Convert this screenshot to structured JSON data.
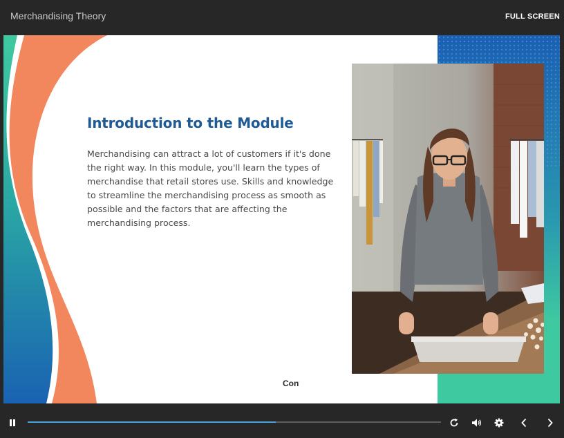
{
  "header": {
    "title": "Merchandising Theory",
    "fullscreen_label": "FULL SCREEN"
  },
  "slide": {
    "heading": "Introduction to the Module",
    "body": "Merchandising can attract a lot of customers if it's done the right way. In this module, you'll learn the types of merchandise that retail stores use. Skills and knowledge to streamline the merchandising process as smooth as possible and the factors that are affecting the merchandising process.",
    "continue_label": "Continue"
  },
  "player": {
    "progress": 0.6
  },
  "colors": {
    "heading": "#1f5a94",
    "accent_orange": "#f2865c",
    "teal": "#3fc9a0",
    "blue": "#1a62b2",
    "progress": "#46a3e0"
  },
  "icons": {
    "pause": "pause-icon",
    "replay": "replay-icon",
    "volume": "volume-icon",
    "settings": "gear-icon",
    "prev": "chevron-left-icon",
    "next": "chevron-right-icon"
  }
}
